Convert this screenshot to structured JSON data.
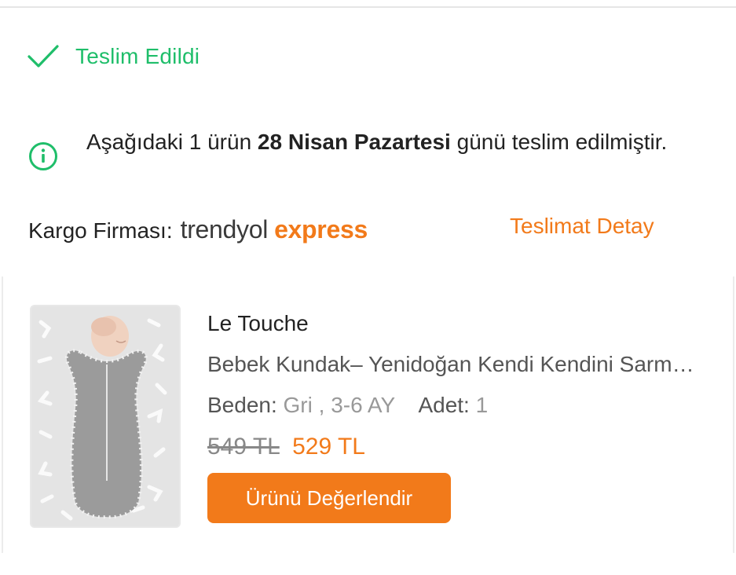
{
  "status": {
    "icon": "check-icon",
    "label": "Teslim Edildi",
    "color": "#1fbe6a"
  },
  "info": {
    "icon": "info-icon",
    "text_before": "Aşağıdaki 1 ürün ",
    "date_bold": "28 Nisan Pazartesi",
    "text_after": " günü teslim edilmiştir."
  },
  "cargo": {
    "label": "Kargo Firması:",
    "brand_part1": "trendyol",
    "brand_part2": "express",
    "detail_link": "Teslimat Detay"
  },
  "product": {
    "image": "baby-swaddle-product-image",
    "brand": "Le Touche",
    "name": "Bebek Kundak– Yenidoğan Kendi Kendini Sarmalayan Kundak",
    "size_label": "Beden:",
    "size_value": "Gri , 3-6 AY",
    "qty_label": "Adet:",
    "qty_value": "1",
    "old_price": "549 TL",
    "new_price": "529 TL",
    "review_button": "Ürünü Değerlendir"
  },
  "colors": {
    "accent": "#f27a1a",
    "success": "#1fbe6a"
  }
}
